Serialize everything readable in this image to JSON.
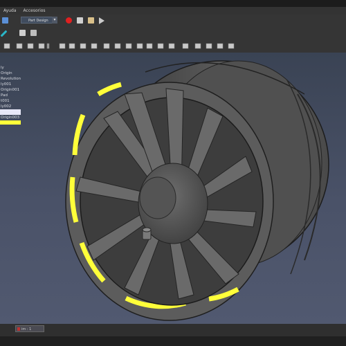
{
  "menu": {
    "items": [
      "Ayuda",
      "Accesorios"
    ]
  },
  "workbench": {
    "selected": "Part Design"
  },
  "tree": {
    "items": [
      "ly",
      "Origin",
      "Revolution",
      "ly001",
      "Origin001",
      "Pad",
      "t001",
      "ly002",
      "",
      "Origin003",
      ""
    ]
  },
  "document_tab": {
    "label": "im : 1"
  },
  "colors": {
    "selection": "#ffff3a",
    "viewport_top": "#3a4354",
    "viewport_bottom": "#515970"
  }
}
